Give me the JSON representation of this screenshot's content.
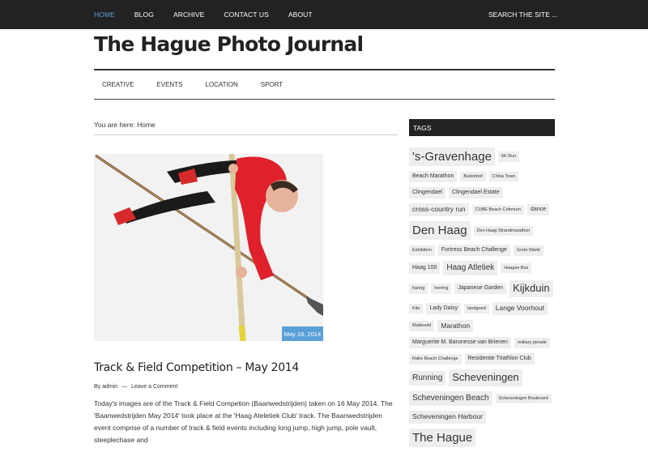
{
  "top_nav": {
    "items": [
      {
        "label": "HOME",
        "active": true
      },
      {
        "label": "BLOG",
        "active": false
      },
      {
        "label": "ARCHIVE",
        "active": false
      },
      {
        "label": "CONTACT US",
        "active": false
      },
      {
        "label": "ABOUT",
        "active": false
      }
    ],
    "search_placeholder": "SEARCH THE SITE ..."
  },
  "site_title": "The Hague Photo Journal",
  "secondary_nav": [
    "CREATIVE",
    "EVENTS",
    "LOCATION",
    "SPORT"
  ],
  "breadcrumb": "You are here: Home",
  "post": {
    "date": "May 16, 2014",
    "title": "Track & Field Competition – May 2014",
    "meta_by": "By",
    "author": "admin",
    "separator": "—",
    "comment_link": "Leave a Comment",
    "excerpt": "Today's images are of the Track & Field Competion (Baanwedstrijden) taken on 16 May 2014. The 'Baanwedstrijden May 2014' took place at the 'Haag Ateletiek Club' track. The Baanwedstrijden event comprise of a number of track & field events including long jump, high jump, pole vault, steeplechase and"
  },
  "sidebar": {
    "tags_heading": "TAGS",
    "tags": [
      {
        "label": "'s-Gravenhage",
        "size": 6
      },
      {
        "label": "5K Run",
        "size": 1
      },
      {
        "label": "Beach Marathon",
        "size": 2
      },
      {
        "label": "Buitenhof",
        "size": 1
      },
      {
        "label": "China Town",
        "size": 1
      },
      {
        "label": "Clingendael",
        "size": 2
      },
      {
        "label": "Clingendael Estate",
        "size": 2
      },
      {
        "label": "cross-country run",
        "size": 3
      },
      {
        "label": "CUBE Beach Criterium",
        "size": 1
      },
      {
        "label": "dance",
        "size": 2
      },
      {
        "label": "Den Haag",
        "size": 6
      },
      {
        "label": "Den Haag Strandmarathon",
        "size": 1
      },
      {
        "label": "Exhibition",
        "size": 1
      },
      {
        "label": "Fortress Beach Challenge",
        "size": 2
      },
      {
        "label": "Grote Markt",
        "size": 1
      },
      {
        "label": "Haag 100",
        "size": 2
      },
      {
        "label": "Haag Atletiek",
        "size": 4
      },
      {
        "label": "Haagse Bos",
        "size": 1
      },
      {
        "label": "haring",
        "size": 1
      },
      {
        "label": "herring",
        "size": 1
      },
      {
        "label": "Japanese Garden",
        "size": 2
      },
      {
        "label": "Kijkduin",
        "size": 5
      },
      {
        "label": "Kite",
        "size": 1
      },
      {
        "label": "Lady Daisy",
        "size": 2
      },
      {
        "label": "landgoed",
        "size": 1
      },
      {
        "label": "Lange Voorhout",
        "size": 3
      },
      {
        "label": "Malieveld",
        "size": 1
      },
      {
        "label": "Marathon",
        "size": 3
      },
      {
        "label": "Marguerite M. Baronesse van Brienen",
        "size": 2
      },
      {
        "label": "military perade",
        "size": 1
      },
      {
        "label": "Rabo Beach Challenge",
        "size": 1
      },
      {
        "label": "Residentie Triathlon Club",
        "size": 2
      },
      {
        "label": "Running",
        "size": 4
      },
      {
        "label": "Scheveningen",
        "size": 5
      },
      {
        "label": "Scheveningen Beach",
        "size": 4
      },
      {
        "label": "Scheveningen Boulevard",
        "size": 1
      },
      {
        "label": "Scheveningen Harbour",
        "size": 3
      },
      {
        "label": "The Hague",
        "size": 6
      }
    ]
  },
  "colors": {
    "topbar": "#222222",
    "accent": "#5aa0d8",
    "tag_bg": "#eeeeee"
  }
}
